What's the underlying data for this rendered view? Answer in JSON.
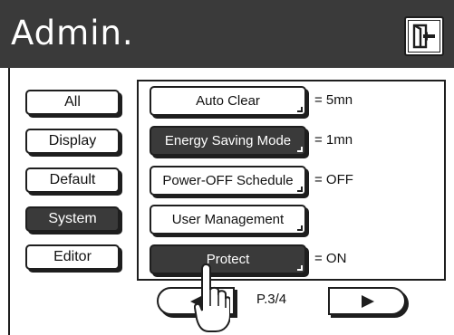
{
  "header": {
    "title": "Admin.",
    "exit_icon": "exit-door-icon"
  },
  "categories": [
    {
      "label": "All",
      "selected": false
    },
    {
      "label": "Display",
      "selected": false
    },
    {
      "label": "Default",
      "selected": false
    },
    {
      "label": "System",
      "selected": true
    },
    {
      "label": "Editor",
      "selected": false
    }
  ],
  "settings": [
    {
      "label": "Auto Clear",
      "value": "= 5mn",
      "active": false
    },
    {
      "label": "Energy Saving Mode",
      "value": "= 1mn",
      "active": true
    },
    {
      "label": "Power-OFF Schedule",
      "value": "= OFF",
      "active": false
    },
    {
      "label": "User Management",
      "value": "",
      "active": false
    },
    {
      "label": "Protect",
      "value": "= ON",
      "active": true
    }
  ],
  "pager": {
    "indicator": "P.3/4",
    "prev_icon": "left-arrow-icon",
    "next_icon": "right-arrow-icon"
  },
  "cursor": {
    "icon": "hand-pointer-icon"
  },
  "colors": {
    "dark": "#3a3a3a",
    "outline": "#1e1e1e",
    "light": "#ffffff"
  }
}
